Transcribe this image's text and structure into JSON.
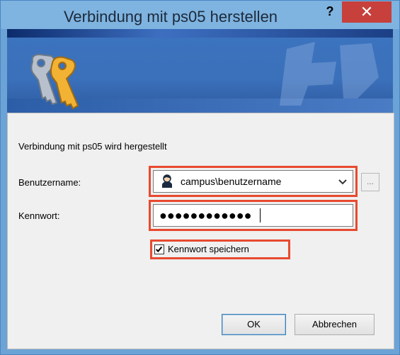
{
  "title": "Verbindung mit ps05 herstellen",
  "titlebar": {
    "help_label": "?",
    "close_label": "✕"
  },
  "info_text": "Verbindung mit ps05 wird hergestellt",
  "username": {
    "label": "Benutzername:",
    "value": "campus\\benutzername",
    "browse_label": "..."
  },
  "password": {
    "label": "Kennwort:",
    "value": "●●●●●●●●●●●●"
  },
  "remember": {
    "label": "Kennwort speichern",
    "checked": true
  },
  "buttons": {
    "ok": "OK",
    "cancel": "Abbrechen"
  },
  "colors": {
    "highlight": "#e84a2f",
    "banner": "#3b70ba",
    "close": "#c7403b"
  },
  "icons": [
    "keys-icon",
    "user-icon",
    "chevron-down-icon",
    "checkmark-icon",
    "help-icon",
    "close-icon"
  ]
}
